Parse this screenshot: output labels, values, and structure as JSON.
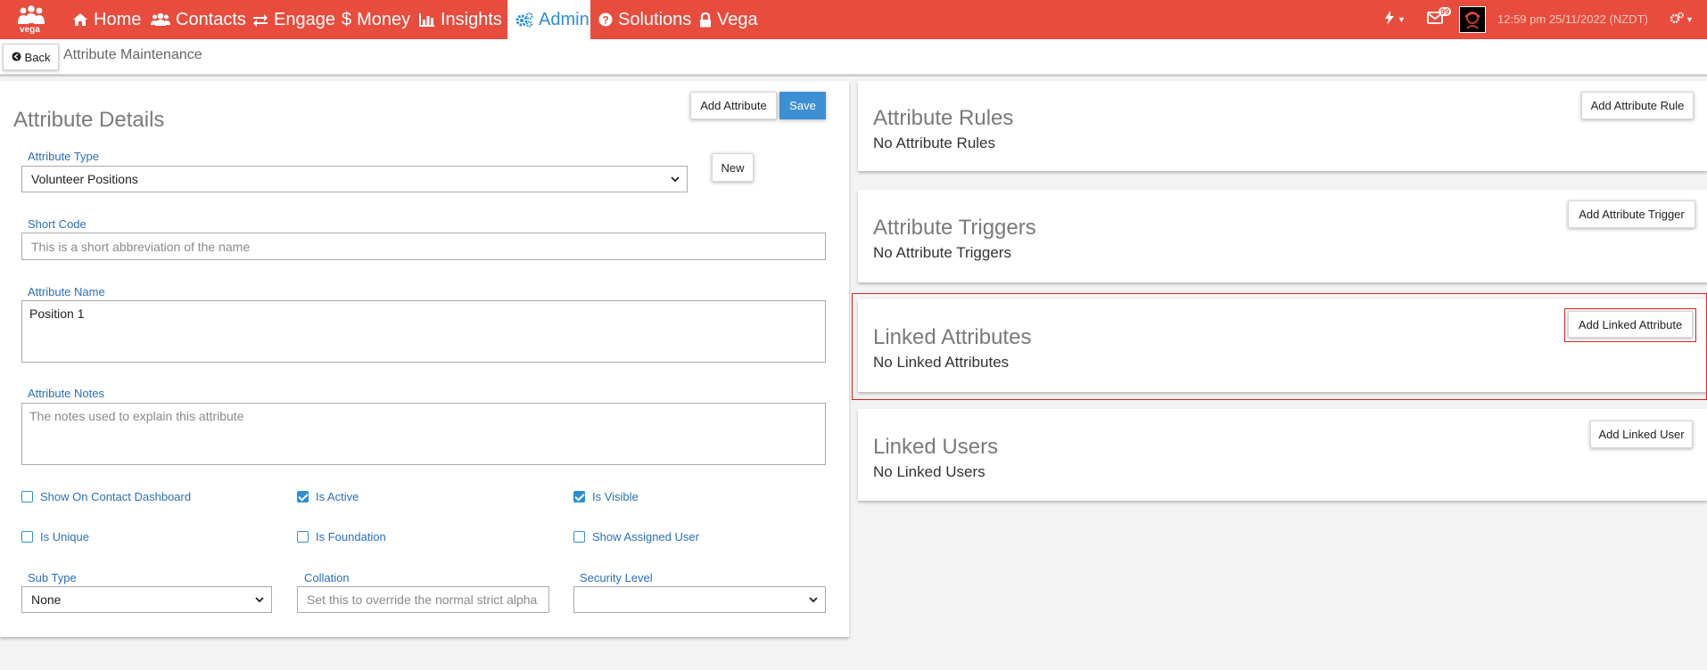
{
  "nav": {
    "logo_text": "vega",
    "items": [
      {
        "label": "Home",
        "icon": "home-icon"
      },
      {
        "label": "Contacts",
        "icon": "users-icon"
      },
      {
        "label": "Engage",
        "icon": "exchange-icon"
      },
      {
        "label": "Money",
        "icon": "dollar-icon"
      },
      {
        "label": "Insights",
        "icon": "bar-chart-icon"
      },
      {
        "label": "Admin",
        "icon": "cogs-icon"
      },
      {
        "label": "Solutions",
        "icon": "question-circle-icon"
      },
      {
        "label": "Vega",
        "icon": "lock-icon"
      }
    ],
    "active": "Admin",
    "notification_count": "99",
    "datetime": "12:59 pm 25/11/2022 (NZDT)"
  },
  "subheader": {
    "back_label": "Back",
    "page_title": "Attribute Maintenance"
  },
  "details": {
    "title": "Attribute Details",
    "add_attribute_label": "Add Attribute",
    "save_label": "Save",
    "new_label": "New",
    "attribute_type": {
      "label": "Attribute Type",
      "value": "Volunteer Positions"
    },
    "short_code": {
      "label": "Short Code",
      "placeholder": "This is a short abbreviation of the name",
      "value": ""
    },
    "attribute_name": {
      "label": "Attribute Name",
      "value": "Position 1"
    },
    "attribute_notes": {
      "label": "Attribute Notes",
      "placeholder": "The notes used to explain this attribute",
      "value": ""
    },
    "checkboxes": [
      {
        "label": "Show On Contact Dashboard",
        "checked": false
      },
      {
        "label": "Is Active",
        "checked": true
      },
      {
        "label": "Is Visible",
        "checked": true
      },
      {
        "label": "Is Unique",
        "checked": false
      },
      {
        "label": "Is Foundation",
        "checked": false
      },
      {
        "label": "Show Assigned User",
        "checked": false
      }
    ],
    "sub_type": {
      "label": "Sub Type",
      "value": "None"
    },
    "collation": {
      "label": "Collation",
      "placeholder": "Set this to override the normal strict alpha",
      "value": ""
    },
    "security_level": {
      "label": "Security Level",
      "value": ""
    }
  },
  "rules": {
    "title": "Attribute Rules",
    "empty": "No Attribute Rules",
    "button": "Add Attribute Rule"
  },
  "triggers": {
    "title": "Attribute Triggers",
    "empty": "No Attribute Triggers",
    "button": "Add Attribute Trigger"
  },
  "linked_attributes": {
    "title": "Linked Attributes",
    "empty": "No Linked Attributes",
    "button": "Add Linked Attribute"
  },
  "linked_users": {
    "title": "Linked Users",
    "empty": "No Linked Users",
    "button": "Add Linked User"
  },
  "colors": {
    "nav_bg": "#e84c3d",
    "accent": "#2b8fd6",
    "highlight": "#e02020"
  }
}
